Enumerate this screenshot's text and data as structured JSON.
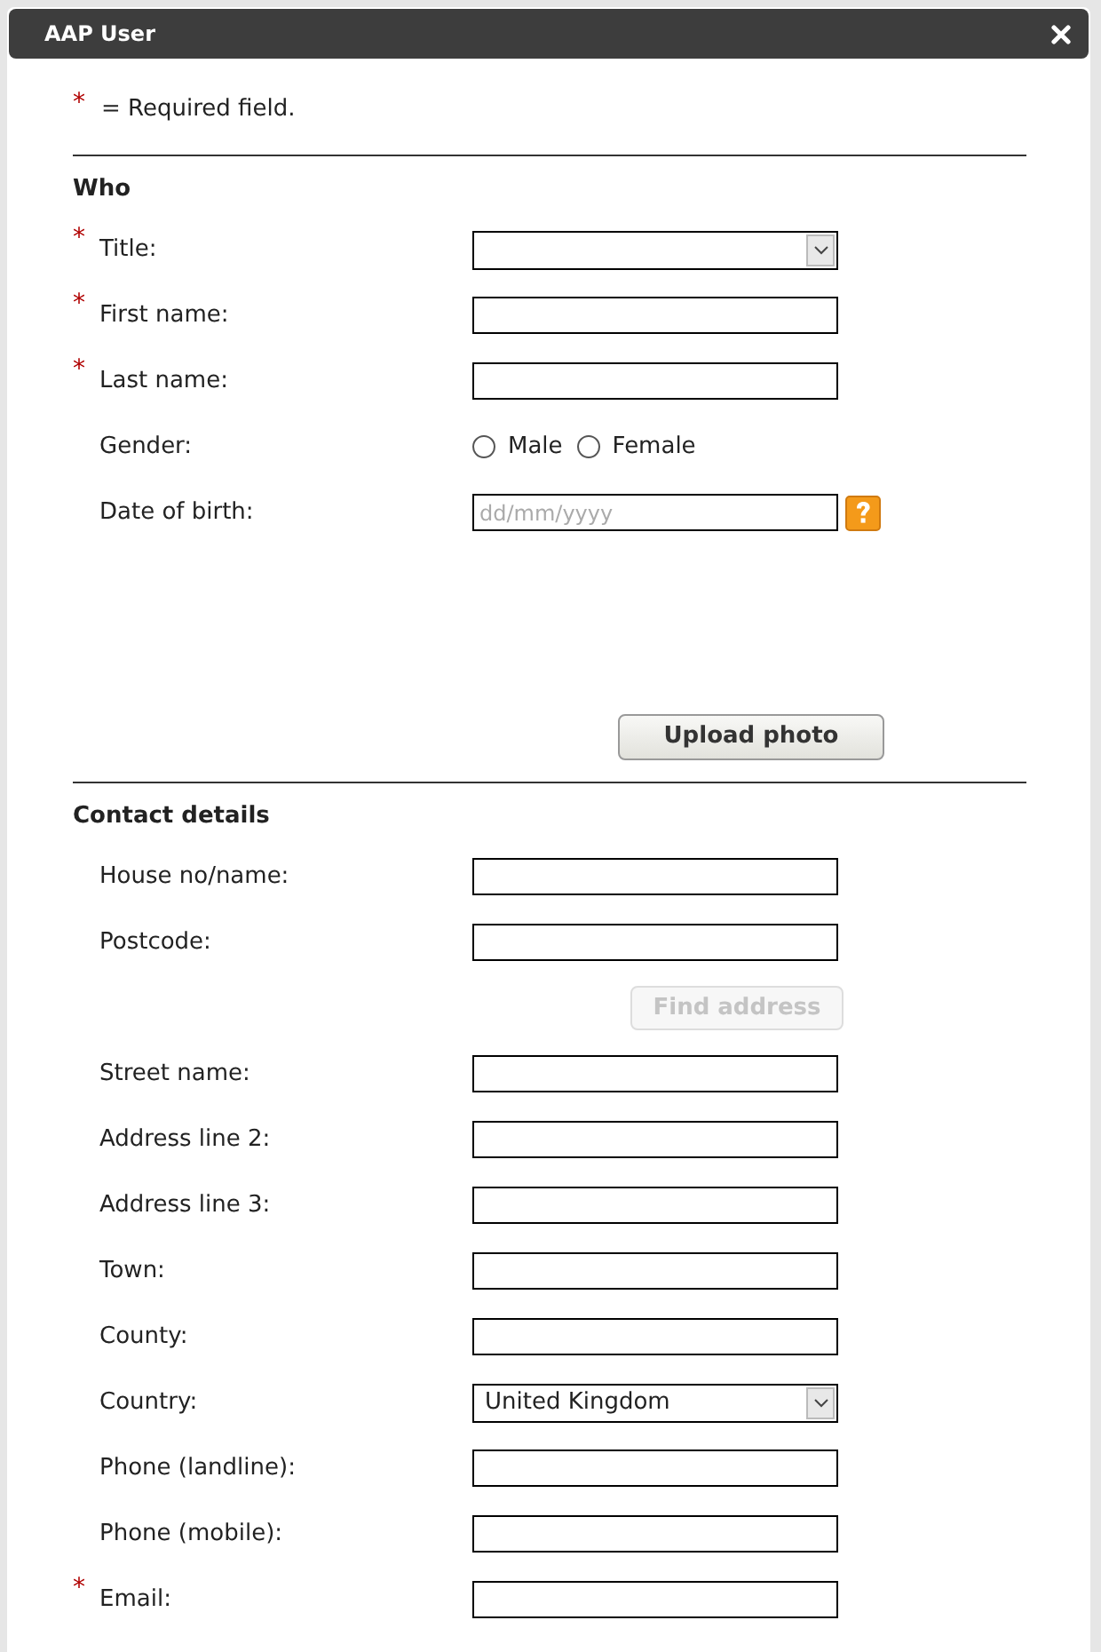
{
  "window": {
    "title": "AAP User"
  },
  "required_note": {
    "marker": "*",
    "text": "= Required field."
  },
  "sections": [
    {
      "heading": "Who",
      "fields": [
        {
          "kind": "select",
          "label": "Title:",
          "marker": "*"
        },
        {
          "kind": "text",
          "label": "First name:",
          "marker": "*"
        },
        {
          "kind": "text",
          "label": "Last name:",
          "marker": "*"
        },
        {
          "kind": "radio",
          "label": "Gender:",
          "options": [
            {
              "label": "Male",
              "selected": false
            },
            {
              "label": "Female",
              "selected": false
            }
          ]
        },
        {
          "kind": "date",
          "label": "Date of birth:",
          "placeholder": "dd/mm/yyyy"
        },
        {
          "kind": "button",
          "label": "Upload photo",
          "disabled": false
        }
      ]
    },
    {
      "heading": "Contact details",
      "fields": [
        {
          "kind": "text",
          "label": "House no/name:"
        },
        {
          "kind": "text",
          "label": "Postcode:"
        },
        {
          "kind": "button",
          "label": "Find address",
          "disabled": true
        },
        {
          "kind": "text",
          "label": "Street name:"
        },
        {
          "kind": "text",
          "label": "Address line 2:"
        },
        {
          "kind": "text",
          "label": "Address line 3:"
        },
        {
          "kind": "text",
          "label": "Town:"
        },
        {
          "kind": "text",
          "label": "County:"
        },
        {
          "kind": "select",
          "label": "Country:",
          "value": "United Kingdom"
        },
        {
          "kind": "text",
          "label": "Phone (landline):"
        },
        {
          "kind": "text",
          "label": "Phone (mobile):"
        },
        {
          "kind": "text",
          "label": "Email:",
          "marker": "*"
        }
      ]
    }
  ]
}
